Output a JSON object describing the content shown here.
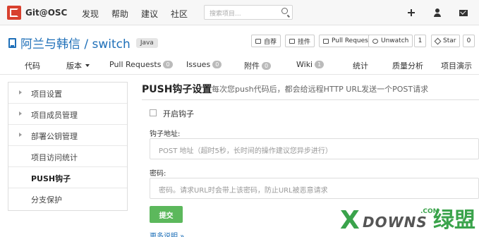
{
  "topnav": {
    "logo_text": "Git@OSC",
    "links": [
      "发现",
      "帮助",
      "建议",
      "社区"
    ],
    "search_placeholder": "搜索项目..."
  },
  "project": {
    "title": "阿兰与韩信 / switch",
    "language": "Java",
    "actions": {
      "fork": "自荐",
      "pin": "挂件",
      "pull_request": "Pull Request",
      "watch": "Unwatch",
      "watch_count": "1",
      "star": "Star",
      "star_count": "0"
    }
  },
  "tabs": [
    {
      "label": "代码"
    },
    {
      "label": "版本"
    },
    {
      "label": "Pull Requests",
      "count": "0"
    },
    {
      "label": "Issues",
      "count": "0"
    },
    {
      "label": "附件",
      "count": "0"
    },
    {
      "label": "Wiki",
      "count": "1"
    },
    {
      "label": "统计"
    },
    {
      "label": "质量分析"
    },
    {
      "label": "项目演示"
    }
  ],
  "sidebar": {
    "items": [
      {
        "label": "项目设置",
        "expandable": true
      },
      {
        "label": "项目成员管理",
        "expandable": true
      },
      {
        "label": "部署公钥管理",
        "expandable": true
      },
      {
        "label": "项目访问统计",
        "expandable": false
      },
      {
        "label": "PUSH钩子",
        "expandable": false,
        "active": true
      },
      {
        "label": "分支保护",
        "expandable": false
      }
    ]
  },
  "main": {
    "title": "PUSH钩子设置",
    "description": "每次您push代码后，都会给远程HTTP URL发送一个POST请求",
    "enable_hook_label": "开启钩子",
    "hook_url_label": "钩子地址:",
    "hook_url_placeholder": "POST 地址（超时5秒，长时间的操作建议您异步进行）",
    "password_label": "密码:",
    "password_placeholder": "密码。请求URL时会带上该密码，防止URL被恶意请求",
    "submit_label": "提交",
    "more_link": "更多说明 »"
  },
  "watermark": {
    "x": "X",
    "downs": "DOWNS",
    "com": ".COM",
    "cn": "绿盟"
  },
  "colors": {
    "brand_red": "#d8402e",
    "link_blue": "#1e6fb8",
    "submit_green": "#5cb85c",
    "watermark_green": "#3aa34b"
  }
}
